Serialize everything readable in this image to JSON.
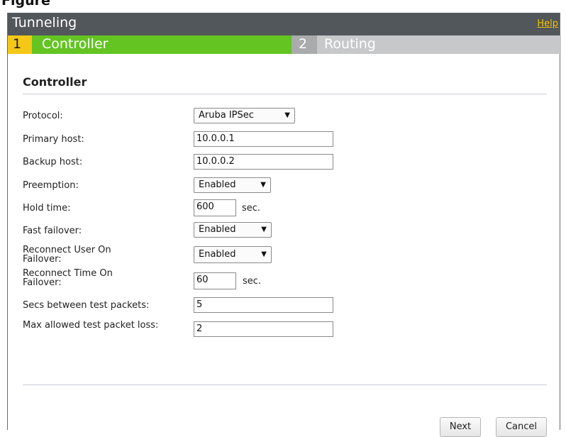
{
  "caption": "Figure",
  "window": {
    "title": "Tunneling",
    "help_label": "Help"
  },
  "steps": [
    {
      "number": "1",
      "label": "Controller",
      "active": true
    },
    {
      "number": "2",
      "label": "Routing",
      "active": false
    }
  ],
  "section": {
    "title": "Controller"
  },
  "form": {
    "protocol": {
      "label": "Protocol:",
      "value": "Aruba IPSec"
    },
    "primary_host": {
      "label": "Primary host:",
      "value": "10.0.0.1"
    },
    "backup_host": {
      "label": "Backup host:",
      "value": "10.0.0.2"
    },
    "preemption": {
      "label": "Preemption:",
      "value": "Enabled"
    },
    "hold_time": {
      "label": "Hold time:",
      "value": "600",
      "unit": "sec."
    },
    "fast_failover": {
      "label": "Fast failover:",
      "value": "Enabled"
    },
    "reconnect_user": {
      "label": "Reconnect User On Failover:",
      "value": "Enabled"
    },
    "reconnect_time": {
      "label": "Reconnect Time On Failover:",
      "value": "60",
      "unit": "sec."
    },
    "secs_between": {
      "label": "Secs between test packets:",
      "value": "5"
    },
    "max_loss": {
      "label": "Max allowed test packet loss:",
      "value": "2"
    }
  },
  "buttons": {
    "next": "Next",
    "cancel": "Cancel"
  },
  "colors": {
    "titlebar": "#52575b",
    "help_link": "#f2c200",
    "step_active_number": "#f5c817",
    "step_active": "#63c422",
    "step_inactive": "#c6c8ca"
  }
}
